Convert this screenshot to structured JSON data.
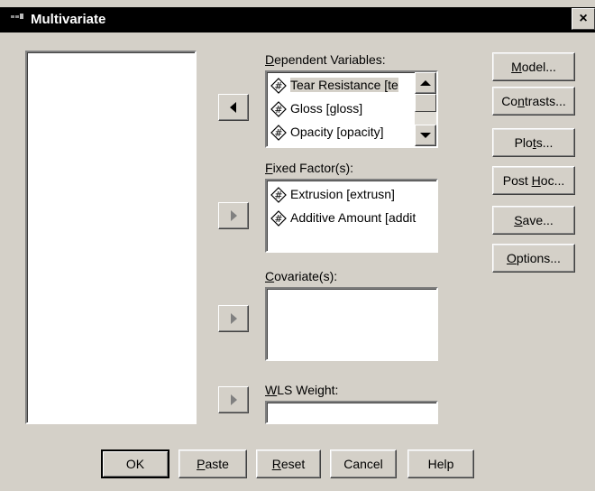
{
  "window": {
    "title": "Multivariate",
    "close_glyph": "×"
  },
  "dependent": {
    "label_mnemonic": "D",
    "label_rest": "ependent Variables:",
    "items": [
      "Tear Resistance [te",
      "Gloss [gloss]",
      "Opacity [opacity]"
    ]
  },
  "fixed": {
    "label_mnemonic": "F",
    "label_rest": "ixed Factor(s):",
    "items": [
      "Extrusion [extrusn]",
      "Additive Amount [addit"
    ]
  },
  "covariate": {
    "label_mnemonic": "C",
    "label_rest": "ovariate(s):"
  },
  "wls": {
    "label_mnemonic": "W",
    "label_rest": "LS Weight:",
    "value": ""
  },
  "side_buttons": {
    "model": {
      "m": "M",
      "rest": "odel..."
    },
    "contrasts": {
      "pre": "Co",
      "m": "n",
      "rest": "trasts..."
    },
    "plots": {
      "pre": "Plo",
      "m": "t",
      "rest": "s..."
    },
    "posthoc": {
      "pre": "Post ",
      "m": "H",
      "rest": "oc..."
    },
    "save": {
      "m": "S",
      "rest": "ave..."
    },
    "options": {
      "m": "O",
      "rest": "ptions..."
    }
  },
  "bottom_buttons": {
    "ok": "OK",
    "paste": {
      "m": "P",
      "rest": "aste"
    },
    "reset": {
      "m": "R",
      "rest": "eset"
    },
    "cancel": "Cancel",
    "help": "Help"
  },
  "icons": {
    "variable": "scale-variable-icon",
    "arrow_left": "left-triangle",
    "arrow_right": "right-triangle"
  }
}
